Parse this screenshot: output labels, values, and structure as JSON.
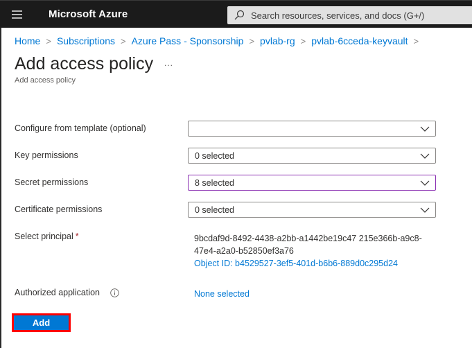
{
  "topbar": {
    "menu_icon": "hamburger-menu-icon",
    "brand": "Microsoft Azure",
    "search": {
      "icon": "search-icon",
      "placeholder": "Search resources, services, and docs (G+/)"
    }
  },
  "breadcrumb": {
    "items": [
      "Home",
      "Subscriptions",
      "Azure Pass - Sponsorship",
      "pvlab-rg",
      "pvlab-6cceda-keyvault"
    ],
    "separator": ">"
  },
  "page": {
    "title": "Add access policy",
    "more_label": "...",
    "subtitle": "Add access policy"
  },
  "form": {
    "template": {
      "label": "Configure from template (optional)",
      "value": ""
    },
    "key_permissions": {
      "label": "Key permissions",
      "value": "0 selected"
    },
    "secret_permissions": {
      "label": "Secret permissions",
      "value": "8 selected"
    },
    "certificate_permissions": {
      "label": "Certificate permissions",
      "value": "0 selected"
    },
    "principal": {
      "label": "Select principal",
      "required_mark": "*",
      "value": "9bcdaf9d-8492-4438-a2bb-a1442be19c47 215e366b-a9c8-47e4-a2a0-b52850ef3a76",
      "object_id": "Object ID: b4529527-3ef5-401d-b6b6-889d0c295d24"
    },
    "authorized_application": {
      "label": "Authorized application",
      "info_icon": "info-icon",
      "value": "None selected"
    },
    "add_button": "Add"
  },
  "colors": {
    "topbar_bg": "#1b1b1b",
    "link": "#0078d4",
    "primary_button": "#0078d4",
    "highlight_border": "#ff0000",
    "active_dropdown_border": "#8a2fb2",
    "required": "#a4262c"
  }
}
